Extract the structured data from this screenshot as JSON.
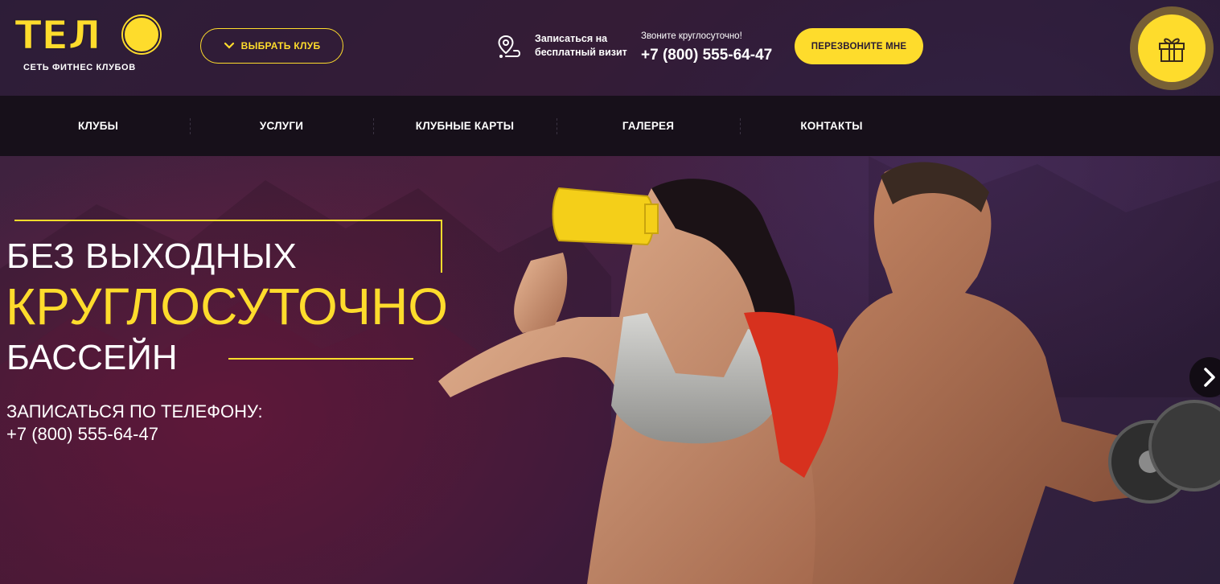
{
  "logo": {
    "letters": "ТЕЛ",
    "tagline": "СЕТЬ ФИТНЕС КЛУБОВ"
  },
  "header": {
    "club_button_label": "ВЫБРАТЬ КЛУБ",
    "visit_line1": "Записаться на",
    "visit_line2": "бесплатный визит",
    "phone_note": "Звоните круглосуточно!",
    "phone": "+7 (800) 555-64-47",
    "callback_label": "ПЕРЕЗВОНИТЕ МНЕ"
  },
  "nav": {
    "items": [
      {
        "label": "КЛУБЫ"
      },
      {
        "label": "УСЛУГИ"
      },
      {
        "label": "КЛУБНЫЕ КАРТЫ"
      },
      {
        "label": "ГАЛЕРЕЯ"
      },
      {
        "label": "КОНТАКТЫ"
      }
    ]
  },
  "hero": {
    "line1": "БЕЗ ВЫХОДНЫХ",
    "line2": "КРУГЛОСУТОЧНО",
    "line3": "БАССЕЙН",
    "signup_label": "ЗАПИСАТЬСЯ ПО ТЕЛЕФОНУ:",
    "signup_phone": "+7 (800) 555-64-47"
  },
  "icons": {
    "club_button": "chevron-down-icon",
    "visit": "map-pin-route-icon",
    "gift": "gift-icon",
    "slider_next": "chevron-right-icon"
  },
  "colors": {
    "accent": "#fedc2c",
    "nav_background": "#17101a",
    "text": "#ffffff"
  }
}
